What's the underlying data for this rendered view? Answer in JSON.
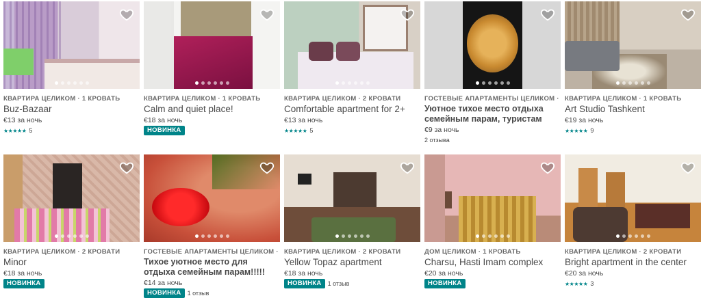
{
  "colors": {
    "accent": "#008489",
    "text": "#484848",
    "muted": "#6a6a6a"
  },
  "listings": [
    {
      "type": "КВАРТИРА ЦЕЛИКОМ · 1 КРОВАТЬ",
      "title": "Buz-Bazaar",
      "price": "€13 за ночь",
      "stars": "★★★★★",
      "rating": 5,
      "reviews": "5",
      "badge": "",
      "favorite_icon": "heart-icon",
      "photos": 6
    },
    {
      "type": "КВАРТИРА ЦЕЛИКОМ · 1 КРОВАТЬ",
      "title": "Calm and quiet place!",
      "price": "€18 за ночь",
      "stars": "",
      "rating": null,
      "reviews": "",
      "badge": "НОВИНКА",
      "favorite_icon": "heart-icon",
      "photos": 6
    },
    {
      "type": "КВАРТИРА ЦЕЛИКОМ · 2 КРОВАТИ",
      "title": "Comfortable apartment for 2+",
      "price": "€13 за ночь",
      "stars": "★★★★★",
      "rating": 5,
      "reviews": "5",
      "badge": "",
      "favorite_icon": "heart-icon",
      "photos": 6
    },
    {
      "type": "ГОСТЕВЫЕ АПАРТАМЕНТЫ ЦЕЛИКОМ ·",
      "title": "Уютное тихое место отдыха семейным парам, туристам",
      "price": "€9 за ночь",
      "stars": "",
      "rating": null,
      "reviews": "2 отзыва",
      "badge": "",
      "favorite_icon": "heart-icon",
      "photos": 6
    },
    {
      "type": "КВАРТИРА ЦЕЛИКОМ · 1 КРОВАТЬ",
      "title": "Art Studio Tashkent",
      "price": "€19 за ночь",
      "stars": "★★★★★",
      "rating": 5,
      "reviews": "9",
      "badge": "",
      "favorite_icon": "heart-icon",
      "photos": 6
    },
    {
      "type": "КВАРТИРА ЦЕЛИКОМ · 2 КРОВАТИ",
      "title": "Minor",
      "price": "€18 за ночь",
      "stars": "",
      "rating": null,
      "reviews": "",
      "badge": "НОВИНКА",
      "favorite_icon": "heart-icon",
      "photos": 6
    },
    {
      "type": "ГОСТЕВЫЕ АПАРТАМЕНТЫ ЦЕЛИКОМ ·",
      "title": "Тихое уютное место для отдыха семейным парам!!!!!",
      "price": "€14 за ночь",
      "stars": "",
      "rating": null,
      "reviews": "1 отзыв",
      "badge": "НОВИНКА",
      "favorite_icon": "heart-icon",
      "photos": 6
    },
    {
      "type": "КВАРТИРА ЦЕЛИКОМ · 2 КРОВАТИ",
      "title": "Yellow Topaz apartment",
      "price": "€18 за ночь",
      "stars": "",
      "rating": null,
      "reviews": "1 отзыв",
      "badge": "НОВИНКА",
      "favorite_icon": "heart-icon",
      "photos": 6
    },
    {
      "type": "ДОМ ЦЕЛИКОМ · 1 КРОВАТЬ",
      "title": "Charsu, Hasti Imam complex",
      "price": "€20 за ночь",
      "stars": "",
      "rating": null,
      "reviews": "",
      "badge": "НОВИНКА",
      "favorite_icon": "heart-icon",
      "photos": 6
    },
    {
      "type": "КВАРТИРА ЦЕЛИКОМ · 2 КРОВАТИ",
      "title": "Bright apartment in the center",
      "price": "€20 за ночь",
      "stars": "★★★★★",
      "rating": 5,
      "reviews": "3",
      "badge": "",
      "favorite_icon": "heart-icon",
      "photos": 6
    }
  ]
}
